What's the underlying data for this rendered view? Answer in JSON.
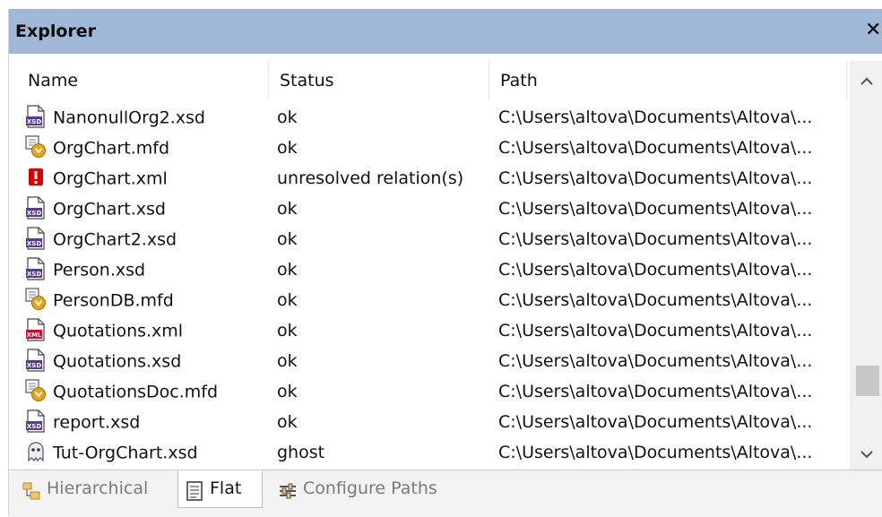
{
  "window": {
    "title": "Explorer",
    "close_glyph": "✕"
  },
  "columns": {
    "name": "Name",
    "status": "Status",
    "path": "Path"
  },
  "rows": [
    {
      "name": "NanonullOrg2.xsd",
      "status": "ok",
      "path": "C:\\Users\\altova\\Documents\\Altova\\...",
      "icon": "xsd-file-icon"
    },
    {
      "name": "OrgChart.mfd",
      "status": "ok",
      "path": "C:\\Users\\altova\\Documents\\Altova\\...",
      "icon": "mapping-file-icon"
    },
    {
      "name": "OrgChart.xml",
      "status": "unresolved relation(s)",
      "path": "C:\\Users\\altova\\Documents\\Altova\\...",
      "icon": "error-icon"
    },
    {
      "name": "OrgChart.xsd",
      "status": "ok",
      "path": "C:\\Users\\altova\\Documents\\Altova\\...",
      "icon": "xsd-file-icon"
    },
    {
      "name": "OrgChart2.xsd",
      "status": "ok",
      "path": "C:\\Users\\altova\\Documents\\Altova\\...",
      "icon": "xsd-file-icon"
    },
    {
      "name": "Person.xsd",
      "status": "ok",
      "path": "C:\\Users\\altova\\Documents\\Altova\\...",
      "icon": "xsd-file-icon"
    },
    {
      "name": "PersonDB.mfd",
      "status": "ok",
      "path": "C:\\Users\\altova\\Documents\\Altova\\...",
      "icon": "mapping-file-icon"
    },
    {
      "name": "Quotations.xml",
      "status": "ok",
      "path": "C:\\Users\\altova\\Documents\\Altova\\...",
      "icon": "xml-file-icon"
    },
    {
      "name": "Quotations.xsd",
      "status": "ok",
      "path": "C:\\Users\\altova\\Documents\\Altova\\...",
      "icon": "xsd-file-icon"
    },
    {
      "name": "QuotationsDoc.mfd",
      "status": "ok",
      "path": "C:\\Users\\altova\\Documents\\Altova\\...",
      "icon": "mapping-file-icon"
    },
    {
      "name": "report.xsd",
      "status": "ok",
      "path": "C:\\Users\\altova\\Documents\\Altova\\...",
      "icon": "xsd-file-icon"
    },
    {
      "name": "Tut-OrgChart.xsd",
      "status": "ghost",
      "path": "C:\\Users\\altova\\Documents\\Altova\\...",
      "icon": "ghost-icon"
    }
  ],
  "tabs": {
    "hierarchical": "Hierarchical",
    "flat": "Flat",
    "configure": "Configure Paths"
  },
  "colors": {
    "titlebar": "#9fb8d6",
    "xsd": "#5a3d8a",
    "xml": "#c8102e",
    "error": "#d60000",
    "mapping": "#e8a317"
  }
}
